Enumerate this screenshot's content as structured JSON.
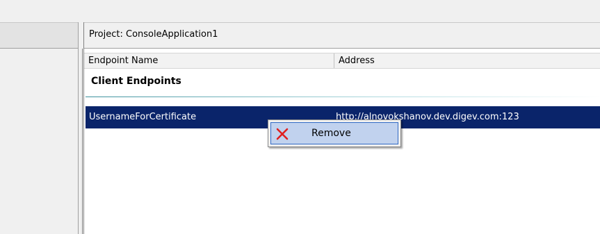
{
  "project": {
    "label": "Project: ConsoleApplication1"
  },
  "table": {
    "columns": [
      "Endpoint Name",
      "Address"
    ],
    "group_header": "Client Endpoints",
    "rows": [
      {
        "name": "UsernameForCertificate",
        "address": "http://alnovokshanov.dev.digev.com:123",
        "selected": true
      }
    ]
  },
  "context_menu": {
    "items": [
      {
        "label": "Remove",
        "icon": "red-x-icon"
      }
    ]
  },
  "colors": {
    "selection": "#0a246a",
    "menu_highlight": "#c1d2ee",
    "menu_border": "#316ac5",
    "remove_icon": "#e02020"
  }
}
